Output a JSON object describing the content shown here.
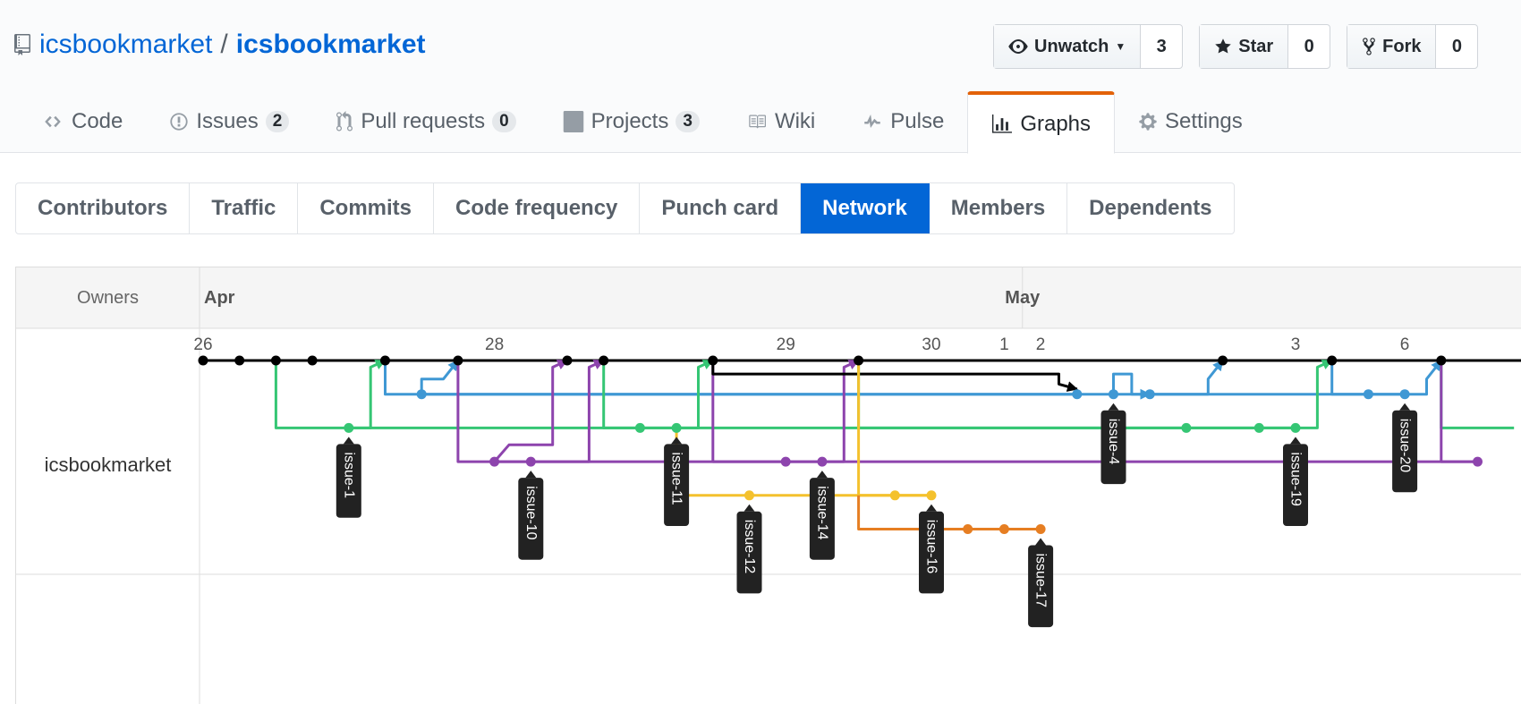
{
  "repo": {
    "owner": "icsbookmarket",
    "separator": "/",
    "name": "icsbookmarket"
  },
  "actions": {
    "watch": {
      "label": "Unwatch",
      "count": "3"
    },
    "star": {
      "label": "Star",
      "count": "0"
    },
    "fork": {
      "label": "Fork",
      "count": "0"
    }
  },
  "tabs": [
    {
      "label": "Code",
      "icon": "code-icon"
    },
    {
      "label": "Issues",
      "icon": "issue-icon",
      "count": "2"
    },
    {
      "label": "Pull requests",
      "icon": "pull-request-icon",
      "count": "0"
    },
    {
      "label": "Projects",
      "icon": "project-icon",
      "count": "3"
    },
    {
      "label": "Wiki",
      "icon": "book-icon"
    },
    {
      "label": "Pulse",
      "icon": "pulse-icon"
    },
    {
      "label": "Graphs",
      "icon": "graph-icon",
      "active": true
    },
    {
      "label": "Settings",
      "icon": "gear-icon"
    }
  ],
  "subnav": [
    "Contributors",
    "Traffic",
    "Commits",
    "Code frequency",
    "Punch card",
    "Network",
    "Members",
    "Dependents"
  ],
  "subnav_selected": "Network",
  "network": {
    "owners_label": "Owners",
    "owner": "icsbookmarket",
    "months": [
      {
        "label": "Apr",
        "slot": 0
      },
      {
        "label": "May",
        "slot": 22.5
      }
    ],
    "days": [
      {
        "label": "26",
        "slot": 0
      },
      {
        "label": "28",
        "slot": 8
      },
      {
        "label": "29",
        "slot": 16
      },
      {
        "label": "30",
        "slot": 20
      },
      {
        "label": "1",
        "slot": 22
      },
      {
        "label": "2",
        "slot": 23
      },
      {
        "label": "3",
        "slot": 30
      },
      {
        "label": "6",
        "slot": 33
      }
    ],
    "colors": {
      "black": "#000000",
      "blue": "#3f98d4",
      "green": "#35c674",
      "purple": "#8d44ad",
      "yellow": "#f4c12d",
      "orange": "#e67e22"
    },
    "lanes": [
      {
        "color": "black",
        "row": 0,
        "commits": [
          0,
          1,
          2,
          3,
          5,
          7,
          10,
          11,
          14,
          18,
          28,
          31,
          34
        ]
      },
      {
        "color": "blue",
        "row": 1,
        "commits": [
          6,
          24,
          25,
          26,
          32,
          33
        ]
      },
      {
        "color": "green",
        "row": 2,
        "commits": [
          4,
          12,
          13,
          27,
          29,
          30
        ]
      },
      {
        "color": "purple",
        "row": 3,
        "commits": [
          8,
          9,
          16,
          17,
          35
        ]
      },
      {
        "color": "yellow",
        "row": 4,
        "commits": [
          15,
          19,
          20
        ]
      },
      {
        "color": "orange",
        "row": 5,
        "commits": [
          21,
          22,
          23
        ]
      }
    ],
    "edges": [
      {
        "color": "green",
        "pts": [
          [
            2,
            0
          ],
          [
            2,
            2
          ],
          [
            4,
            2
          ]
        ]
      },
      {
        "color": "green",
        "pts": [
          [
            4,
            2
          ],
          [
            4.6,
            2
          ],
          [
            4.6,
            0.2
          ],
          [
            5,
            0
          ]
        ],
        "arrow": true
      },
      {
        "color": "blue",
        "pts": [
          [
            5,
            0
          ],
          [
            5,
            1
          ],
          [
            6,
            1
          ]
        ]
      },
      {
        "color": "blue",
        "pts": [
          [
            6,
            1
          ],
          [
            6,
            0.55
          ],
          [
            6.6,
            0.55
          ],
          [
            7,
            0
          ]
        ],
        "arrow": true
      },
      {
        "color": "blue",
        "pts": [
          [
            6,
            1
          ],
          [
            24,
            1
          ]
        ]
      },
      {
        "color": "purple",
        "pts": [
          [
            7,
            0
          ],
          [
            7,
            3
          ],
          [
            8,
            3
          ]
        ]
      },
      {
        "color": "purple",
        "pts": [
          [
            8,
            3
          ],
          [
            8.4,
            2.5
          ],
          [
            9.6,
            2.5
          ],
          [
            9.6,
            0.2
          ],
          [
            10,
            0
          ]
        ],
        "arrow": true
      },
      {
        "color": "purple",
        "pts": [
          [
            8,
            3
          ],
          [
            9,
            3
          ],
          [
            10.6,
            3
          ],
          [
            10.6,
            0.2
          ],
          [
            11,
            0
          ]
        ],
        "arrow": true
      },
      {
        "color": "green",
        "pts": [
          [
            11,
            0
          ],
          [
            11,
            2
          ],
          [
            13,
            2
          ]
        ]
      },
      {
        "color": "green",
        "pts": [
          [
            13,
            2
          ],
          [
            13.6,
            2
          ],
          [
            13.6,
            0.2
          ],
          [
            14,
            0
          ]
        ],
        "arrow": true
      },
      {
        "color": "yellow",
        "pts": [
          [
            13,
            2
          ],
          [
            13,
            4
          ],
          [
            15,
            4
          ]
        ]
      },
      {
        "color": "purple",
        "pts": [
          [
            14,
            0
          ],
          [
            14,
            3
          ],
          [
            17,
            3
          ]
        ]
      },
      {
        "color": "purple",
        "pts": [
          [
            17,
            3
          ],
          [
            17.6,
            3
          ],
          [
            17.6,
            0.2
          ],
          [
            18,
            0
          ]
        ],
        "arrow": true
      },
      {
        "color": "black",
        "pts": [
          [
            14,
            0
          ],
          [
            14,
            0.4
          ],
          [
            23.5,
            0.4
          ],
          [
            23.5,
            0.7
          ],
          [
            24,
            0.85
          ]
        ],
        "arrow": true
      },
      {
        "color": "green",
        "pts": [
          [
            18,
            0
          ],
          [
            18,
            2
          ],
          [
            27,
            2
          ],
          [
            30,
            2
          ]
        ]
      },
      {
        "color": "green",
        "pts": [
          [
            30,
            2
          ],
          [
            30.6,
            2
          ],
          [
            30.6,
            0.2
          ],
          [
            31,
            0
          ]
        ],
        "arrow": true
      },
      {
        "color": "yellow",
        "pts": [
          [
            18,
            0
          ],
          [
            18,
            4
          ],
          [
            20,
            4
          ]
        ]
      },
      {
        "color": "orange",
        "pts": [
          [
            18,
            4
          ],
          [
            18,
            5
          ],
          [
            23,
            5
          ]
        ]
      },
      {
        "color": "blue",
        "pts": [
          [
            25,
            1
          ],
          [
            25,
            0.4
          ],
          [
            25.5,
            0.4
          ],
          [
            25.5,
            1
          ],
          [
            26,
            1
          ]
        ],
        "arrow": true
      },
      {
        "color": "blue",
        "pts": [
          [
            26,
            1
          ],
          [
            27.6,
            1
          ],
          [
            27.6,
            0.55
          ],
          [
            28,
            0
          ]
        ],
        "arrow": true
      },
      {
        "color": "blue",
        "pts": [
          [
            31,
            0
          ],
          [
            31,
            1
          ],
          [
            33,
            1
          ]
        ]
      },
      {
        "color": "blue",
        "pts": [
          [
            33,
            1
          ],
          [
            33.6,
            1
          ],
          [
            33.6,
            0.55
          ],
          [
            34,
            0
          ]
        ],
        "arrow": true
      },
      {
        "color": "green",
        "pts": [
          [
            34,
            0
          ],
          [
            34,
            2
          ],
          [
            36,
            2
          ]
        ]
      },
      {
        "color": "purple",
        "pts": [
          [
            34,
            0
          ],
          [
            34,
            3
          ],
          [
            35,
            3
          ]
        ]
      }
    ],
    "labels": [
      {
        "text": "issue-1",
        "slot": 4,
        "row": 2
      },
      {
        "text": "issue-10",
        "slot": 9,
        "row": 3
      },
      {
        "text": "issue-11",
        "slot": 13,
        "row": 2
      },
      {
        "text": "issue-12",
        "slot": 15,
        "row": 4
      },
      {
        "text": "issue-14",
        "slot": 17,
        "row": 3
      },
      {
        "text": "issue-16",
        "slot": 20,
        "row": 4
      },
      {
        "text": "issue-17",
        "slot": 23,
        "row": 5
      },
      {
        "text": "issue-4",
        "slot": 25,
        "row": 1
      },
      {
        "text": "issue-19",
        "slot": 30,
        "row": 2
      },
      {
        "text": "issue-20",
        "slot": 33,
        "row": 1
      }
    ]
  }
}
